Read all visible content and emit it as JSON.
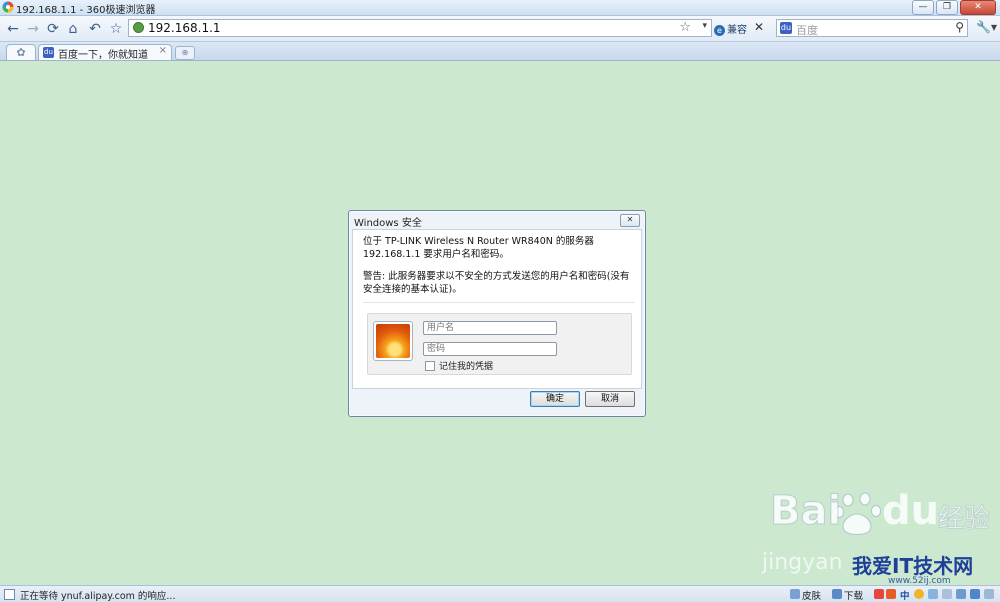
{
  "window": {
    "title": "192.168.1.1 - 360极速浏览器",
    "min": "—",
    "max": "❐",
    "close": "✕"
  },
  "toolbar": {
    "back": "←",
    "forward": "→",
    "refresh": "⟳",
    "home": "⌂",
    "undo": "↶",
    "favorite": "☆",
    "url": "192.168.1.1",
    "addr_star": "☆",
    "addr_dropdown": "▾",
    "compat_icon": "e",
    "compat_label": "兼容",
    "close_x": "✕",
    "search_engine_icon": "du",
    "search_placeholder": "百度",
    "search_icon": "⚲",
    "tools_icon": "🔧▾"
  },
  "tabs": {
    "home_icon": "✿",
    "items": [
      {
        "icon": "du",
        "label": "百度一下，你就知道",
        "close": "×"
      }
    ],
    "new_tab": "⊕"
  },
  "dialog": {
    "title": "Windows 安全",
    "close": "✕",
    "message1": "位于 TP-LINK Wireless N Router WR840N 的服务器 192.168.1.1 要求用户名和密码。",
    "message2": "警告: 此服务器要求以不安全的方式发送您的用户名和密码(没有安全连接的基本认证)。",
    "username_placeholder": "用户名",
    "password_placeholder": "密码",
    "remember_label": "记住我的凭据",
    "ok_label": "确定",
    "cancel_label": "取消"
  },
  "watermark": {
    "baidu": "Bai",
    "du": "du",
    "jingyan": "经验",
    "url": "jingyan",
    "tech": "我爱IT技术网",
    "sub": "www.52ij.com"
  },
  "statusbar": {
    "text": "正在等待 ynuf.alipay.com 的响应...",
    "skin": "皮肤",
    "download": "下载",
    "ime": "中"
  }
}
